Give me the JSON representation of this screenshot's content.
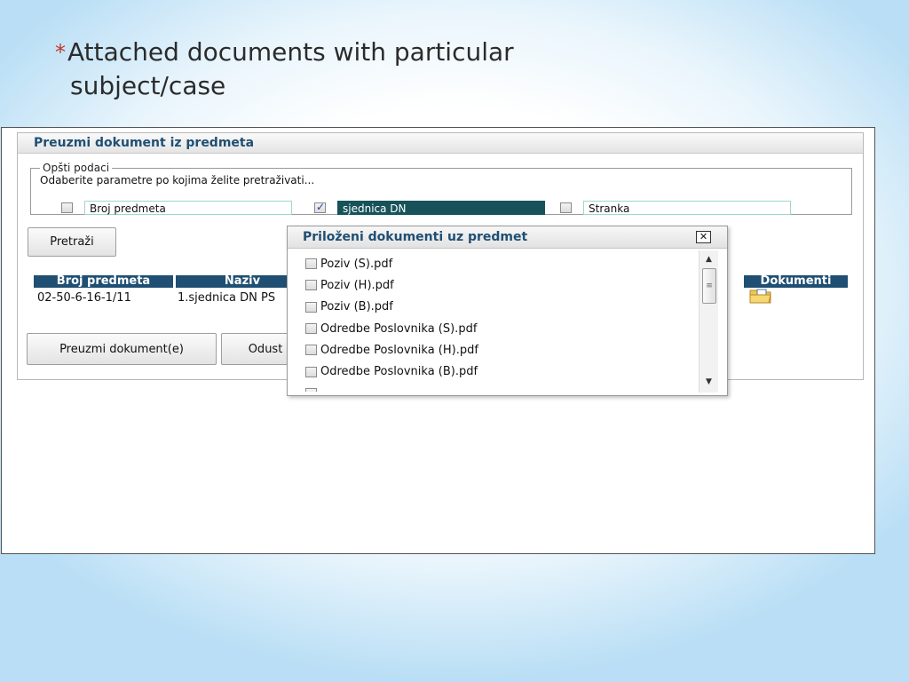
{
  "slide": {
    "bullet": "*",
    "title_line1": "Attached documents with particular",
    "title_line2": "subject/case"
  },
  "panel": {
    "title": "Preuzmi dokument iz predmeta",
    "fieldset_legend": "Opšti podaci",
    "instruction": "Odaberite parametre po kojima želite pretraživati...",
    "params": [
      {
        "label": "Broj predmeta",
        "checked": false
      },
      {
        "label": "sjednica DN",
        "checked": true
      },
      {
        "label": "Stranka",
        "checked": false
      }
    ],
    "search_button": "Pretraži",
    "table": {
      "headers": [
        "Broj predmeta",
        "Naziv",
        "Dokumenti"
      ],
      "row": {
        "broj": "02-50-6-16-1/11",
        "naziv": "1.sjednica DN PS"
      }
    },
    "download_button": "Preuzmi dokument(e)",
    "cancel_button": "Odust"
  },
  "dialog": {
    "title": "Priloženi dokumenti uz predmet",
    "close_label": "✕",
    "documents": [
      "Poziv (S).pdf",
      "Poziv (H).pdf",
      "Poziv (B).pdf",
      "Odredbe Poslovnika (S).pdf",
      "Odredbe Poslovnika (H).pdf",
      "Odredbe Poslovnika (B).pdf"
    ]
  },
  "colors": {
    "header_blue": "#1f4f73",
    "selected_field": "#17525a",
    "bullet_red": "#c0392b"
  }
}
